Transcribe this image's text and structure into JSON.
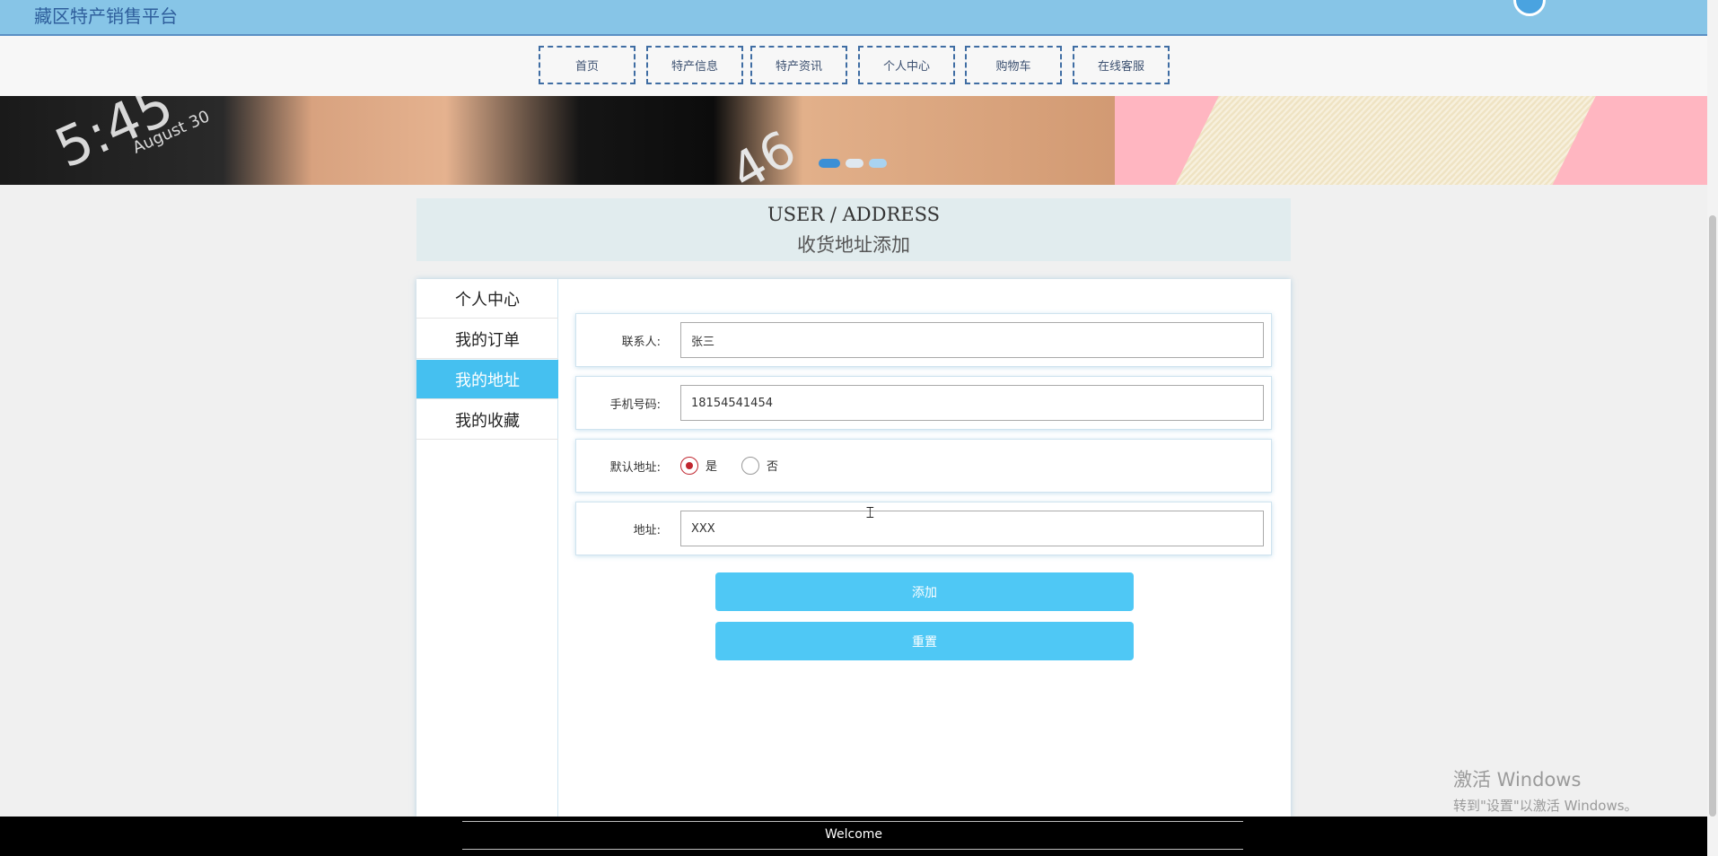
{
  "header": {
    "site_title": "藏区特产销售平台"
  },
  "nav": {
    "items": [
      {
        "label": "首页"
      },
      {
        "label": "特产信息"
      },
      {
        "label": "特产资讯"
      },
      {
        "label": "个人中心"
      },
      {
        "label": "购物车"
      },
      {
        "label": "在线客服"
      }
    ]
  },
  "banner": {
    "text_time": "5:45",
    "text_date": "August 30",
    "text_number": "46",
    "active_dot": 1,
    "dot_count": 3
  },
  "section": {
    "title_en": "USER / ADDRESS",
    "title_zh": "收货地址添加"
  },
  "sidebar": {
    "items": [
      {
        "label": "个人中心",
        "active": false
      },
      {
        "label": "我的订单",
        "active": false
      },
      {
        "label": "我的地址",
        "active": true
      },
      {
        "label": "我的收藏",
        "active": false
      }
    ]
  },
  "form": {
    "contact": {
      "label": "联系人:",
      "value": "张三"
    },
    "phone": {
      "label": "手机号码:",
      "value": "18154541454"
    },
    "default_address": {
      "label": "默认地址:",
      "options": [
        {
          "label": "是",
          "selected": true
        },
        {
          "label": "否",
          "selected": false
        }
      ]
    },
    "address": {
      "label": "地址:",
      "value": "XXX"
    }
  },
  "buttons": {
    "add": "添加",
    "reset": "重置"
  },
  "watermark": {
    "line1": "激活 Windows",
    "line2": "转到\"设置\"以激活 Windows。"
  },
  "footer": {
    "text": "Welcome"
  },
  "colors": {
    "header_bg": "#87c5e7",
    "accent": "#45c0f0",
    "button": "#4fc8f5",
    "radio_checked": "#c0262f"
  }
}
